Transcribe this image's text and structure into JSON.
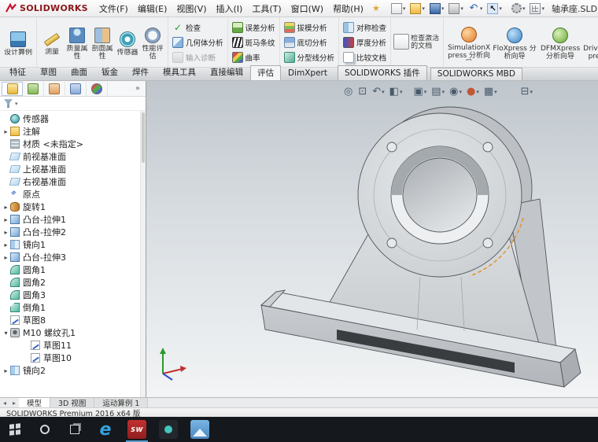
{
  "colors": {
    "accent_orange": "#e2973a",
    "viewport_gradient_top": "#bfc6cc",
    "taskbar_bg": "#15181c",
    "logo_red": "#c8102e"
  },
  "titlebar": {
    "logo_text": "SOLIDWORKS",
    "menus": [
      "文件(F)",
      "编辑(E)",
      "视图(V)",
      "插入(I)",
      "工具(T)",
      "窗口(W)",
      "帮助(H)"
    ],
    "favorites_glyph": "★",
    "quick_icons": [
      {
        "icon": "new-file-icon",
        "arrow": "▾"
      },
      {
        "icon": "open-folder-icon",
        "arrow": "▾"
      },
      {
        "icon": "save-icon",
        "arrow": "▾"
      },
      {
        "icon": "print-icon",
        "arrow": "▾"
      },
      {
        "icon": "undo-icon",
        "arrow": "▾"
      },
      {
        "icon": "select-arrow-icon",
        "arrow": "▾"
      }
    ],
    "right_icons": [
      {
        "icon": "options-gear-icon",
        "arrow": "▾"
      },
      {
        "icon": "display-grid-icon",
        "arrow": "▾"
      }
    ],
    "document_title": "轴承座.SLDPRT"
  },
  "ribbon": {
    "groups": [
      {
        "items": [
          {
            "name": "design-study-button",
            "icon": "design-study-icon",
            "label": "设计算例"
          }
        ]
      },
      {
        "items": [
          {
            "name": "measure-button",
            "icon": "measure-icon",
            "label": "测量"
          },
          {
            "name": "mass-properties-button",
            "icon": "mass-properties-icon",
            "label": "质量属性"
          },
          {
            "name": "section-properties-button",
            "icon": "section-properties-icon",
            "label": "剖面属性"
          },
          {
            "name": "sensor-button",
            "icon": "sensor-icon",
            "label": "传感器"
          },
          {
            "name": "performance-evaluation-button",
            "icon": "performance-icon",
            "label": "性能评估"
          }
        ]
      },
      {
        "items": [
          {
            "name": "check-button",
            "icon": "check-icon",
            "label": "检查"
          },
          {
            "name": "geometry-analysis-button",
            "icon": "geometry-analysis-icon",
            "label": "几何体分析"
          },
          {
            "name": "import-diagnostics-button",
            "icon": "import-diagnostics-icon",
            "label": "输入诊断",
            "row_cls": "disabled"
          }
        ]
      },
      {
        "items": [
          {
            "name": "deviation-analysis-button",
            "icon": "deviation-analysis-icon",
            "label": "误差分析"
          },
          {
            "name": "zebra-stripes-button",
            "icon": "zebra-stripes-icon",
            "label": "斑马条纹"
          },
          {
            "name": "curvature-button",
            "icon": "curvature-icon",
            "label": "曲率"
          }
        ]
      },
      {
        "items": [
          {
            "name": "draft-analysis-button",
            "icon": "draft-analysis-icon",
            "label": "拔模分析"
          },
          {
            "name": "undercut-analysis-button",
            "icon": "undercut-analysis-icon",
            "label": "底切分析"
          },
          {
            "name": "parting-line-analysis-button",
            "icon": "parting-line-icon",
            "label": "分型线分析"
          }
        ]
      },
      {
        "items": [
          {
            "name": "symmetry-check-button",
            "icon": "symmetry-check-icon",
            "label": "对称检查"
          },
          {
            "name": "thickness-analysis-button",
            "icon": "thickness-analysis-icon",
            "label": "厚度分析"
          },
          {
            "name": "compare-documents-button",
            "icon": "compare-documents-icon",
            "label": "比较文档"
          }
        ]
      },
      {
        "items": [
          {
            "name": "check-active-document-button",
            "icon": "check-active-document-icon",
            "label": "检查激活的文档"
          }
        ]
      },
      {
        "items": [
          {
            "name": "simulationxpress-button",
            "icon": "simulationxpress-icon",
            "label": "SimulationXpress 分析向导"
          },
          {
            "name": "floxpress-button",
            "icon": "floxpress-icon",
            "label": "FloXpress 分析向导"
          },
          {
            "name": "dfmxpress-button",
            "icon": "dfmxpress-icon",
            "label": "DFMXpress 分析向导"
          },
          {
            "name": "driveworksxpress-button",
            "icon": "driveworksxpress-icon",
            "label": "DriveWorksXpress 向导"
          }
        ]
      }
    ]
  },
  "command_tabs": {
    "items": [
      {
        "label": "特征"
      },
      {
        "label": "草图"
      },
      {
        "label": "曲面"
      },
      {
        "label": "钣金"
      },
      {
        "label": "焊件"
      },
      {
        "label": "模具工具"
      },
      {
        "label": "直接编辑"
      },
      {
        "label": "评估",
        "row_cls": "active"
      },
      {
        "label": "DimXpert"
      },
      {
        "label": "SOLIDWORKS 插件",
        "row_cls": "boxed"
      },
      {
        "label": "SOLIDWORKS MBD",
        "row_cls": "boxed"
      }
    ]
  },
  "panel": {
    "tabs": [
      {
        "icon": "featuremanager-tree-icon",
        "slot_cls": "active"
      },
      {
        "icon": "propertymanager-icon"
      },
      {
        "icon": "configurationmanager-icon"
      },
      {
        "icon": "dimxpertmanager-icon"
      },
      {
        "icon": "displaymanager-icon"
      }
    ],
    "chevron": "»",
    "filter": {
      "arrow": "▾"
    },
    "tree": [
      {
        "label": "传感器",
        "icon": "sensors-icon",
        "exp": ""
      },
      {
        "label": "注解",
        "icon": "annotations-folder-icon",
        "exp": "▸"
      },
      {
        "label": "材质 <未指定>",
        "icon": "material-icon",
        "exp": ""
      },
      {
        "label": "前视基准面",
        "icon": "plane-icon",
        "exp": ""
      },
      {
        "label": "上视基准面",
        "icon": "plane-icon",
        "exp": ""
      },
      {
        "label": "右视基准面",
        "icon": "plane-icon",
        "exp": ""
      },
      {
        "label": "原点",
        "icon": "origin-icon",
        "exp": ""
      },
      {
        "label": "旋转1",
        "icon": "revolve-icon",
        "exp": "▸"
      },
      {
        "label": "凸台-拉伸1",
        "icon": "extrude-icon",
        "exp": "▸"
      },
      {
        "label": "凸台-拉伸2",
        "icon": "extrude-icon",
        "exp": "▸"
      },
      {
        "label": "镜向1",
        "icon": "mirror-icon",
        "exp": "▸"
      },
      {
        "label": "凸台-拉伸3",
        "icon": "extrude-icon",
        "exp": "▸"
      },
      {
        "label": "圆角1",
        "icon": "fillet-icon",
        "exp": ""
      },
      {
        "label": "圆角2",
        "icon": "fillet-icon",
        "exp": ""
      },
      {
        "label": "圆角3",
        "icon": "fillet-icon",
        "exp": ""
      },
      {
        "label": "倒角1",
        "icon": "chamfer-icon",
        "exp": ""
      },
      {
        "label": "草图8",
        "icon": "sketch-icon",
        "exp": ""
      },
      {
        "label": "M10 螺纹孔1",
        "icon": "thread-hole-icon",
        "exp": "▾"
      },
      {
        "label": "草图11",
        "icon": "sketch-icon",
        "exp": "",
        "row_cls": "child"
      },
      {
        "label": "草图10",
        "icon": "sketch-icon",
        "exp": "",
        "row_cls": "child"
      },
      {
        "label": "镜向2",
        "icon": "mirror-icon",
        "exp": "▸"
      }
    ]
  },
  "viewport": {
    "headsup": [
      {
        "icon": "zoom-fit-icon",
        "glyph": "◎",
        "arrow": ""
      },
      {
        "icon": "zoom-area-icon",
        "glyph": "⊡",
        "arrow": ""
      },
      {
        "icon": "previous-view-icon",
        "glyph": "↶",
        "arrow": "▾"
      },
      {
        "icon": "section-view-icon",
        "glyph": "◧",
        "arrow": "▾"
      },
      {
        "icon": "view-orientation-icon",
        "glyph": "▣",
        "arrow": "▾",
        "slot_cls": "gap"
      },
      {
        "icon": "display-style-icon",
        "glyph": "▤",
        "arrow": "▾"
      },
      {
        "icon": "hide-show-items-icon",
        "glyph": "◉",
        "arrow": "▾"
      },
      {
        "icon": "edit-appearance-icon",
        "glyph": "●",
        "arrow": "▾"
      },
      {
        "icon": "apply-scene-icon",
        "glyph": "▦",
        "arrow": "▾"
      },
      {
        "icon": "view-settings-icon",
        "glyph": "⊟",
        "arrow": "▾",
        "slot_cls": "spaced"
      }
    ]
  },
  "doc_tabs": {
    "nav_left": "◂",
    "nav_right": "▸",
    "items": [
      {
        "label": "模型",
        "row_cls": "active"
      },
      {
        "label": "3D 视图"
      },
      {
        "label": "运动算例 1"
      }
    ]
  },
  "statusbar": {
    "text": "SOLIDWORKS Premium 2016 x64 版"
  },
  "taskbar": {
    "apps": [
      {
        "icon": "edge-icon",
        "glyph": "e"
      },
      {
        "icon": "solidworks-icon",
        "glyph": "SW",
        "slot_cls": "active"
      },
      {
        "icon": "media-app-icon",
        "glyph": ""
      },
      {
        "icon": "photos-icon",
        "glyph": ""
      }
    ]
  }
}
